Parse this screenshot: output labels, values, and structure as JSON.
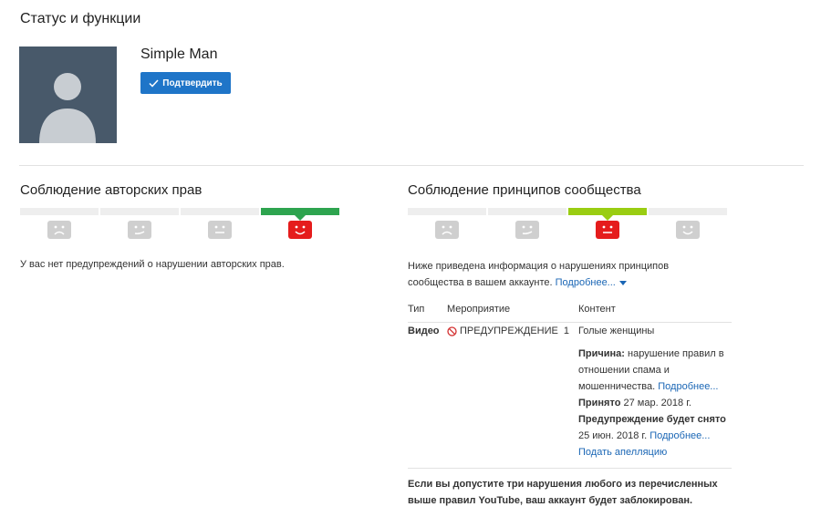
{
  "page": {
    "title": "Статус и функции"
  },
  "channel": {
    "name": "Simple Man",
    "verify_label": "Подтвердить"
  },
  "copyright": {
    "title": "Соблюдение авторских прав",
    "message": "У вас нет предупреждений о нарушении авторских прав.",
    "meter": {
      "levels": 4,
      "active_level": 4,
      "active_color": "#2ea44f"
    }
  },
  "community": {
    "title": "Соблюдение принципов сообщества",
    "meter": {
      "levels": 4,
      "active_level": 3,
      "active_color": "#9acd12"
    },
    "desc_line1": "Ниже приведена информация о нарушениях принципов",
    "desc_line2": "сообщества в вашем аккаунте.",
    "more_label": "Подробнее...",
    "table": {
      "headers": {
        "type": "Тип",
        "action": "Мероприятие",
        "content": "Контент"
      },
      "row": {
        "type": "Видео",
        "action": "ПРЕДУПРЕЖДЕНИЕ",
        "count": "1",
        "content_title": "Голые женщины",
        "reason_label": "Причина:",
        "reason_text": "нарушение правил в отношении спама и мошенничества.",
        "reason_more": "Подробнее...",
        "accepted_label": "Принято",
        "accepted_date": "27 мар. 2018 г.",
        "expires_label": "Предупреждение будет снято",
        "expires_date": "25 июн. 2018 г.",
        "expires_more": "Подробнее...",
        "appeal_label": "Подать апелляцию"
      }
    },
    "footer_note": "Если вы допустите три нарушения любого из перечисленных выше правил YouTube, ваш аккаунт будет заблокирован."
  },
  "colors": {
    "accent": "#1f75c8",
    "link": "#1a66b5",
    "danger": "#e51c1c"
  }
}
